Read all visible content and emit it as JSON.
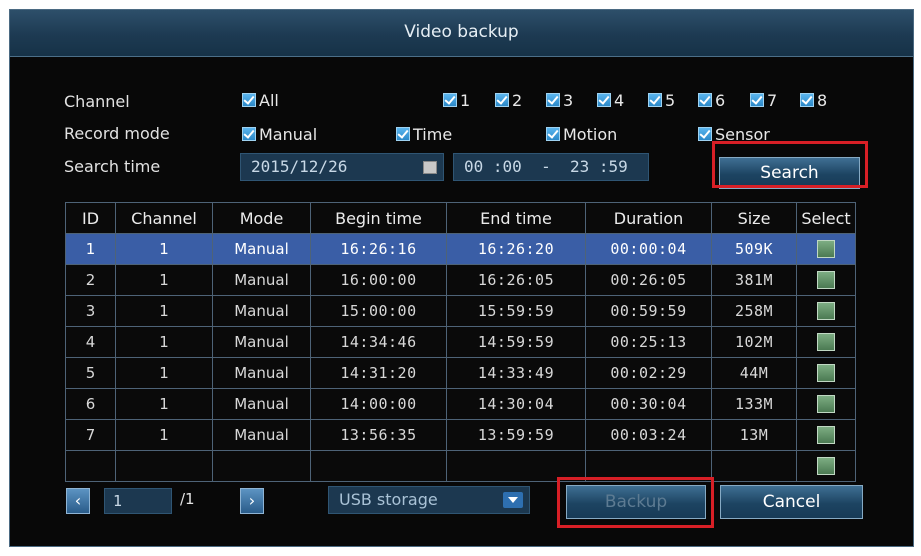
{
  "window": {
    "title": "Video backup"
  },
  "filters": {
    "channel_label": "Channel",
    "all_label": "All",
    "channels": [
      "1",
      "2",
      "3",
      "4",
      "5",
      "6",
      "7",
      "8"
    ],
    "record_mode_label": "Record mode",
    "modes": [
      "Manual",
      "Time",
      "Motion",
      "Sensor"
    ],
    "search_time_label": "Search time",
    "date": "2015/12/26",
    "time_range": "00 :00  -  23 :59",
    "search_button": "Search"
  },
  "table": {
    "headers": [
      "ID",
      "Channel",
      "Mode",
      "Begin time",
      "End time",
      "Duration",
      "Size",
      "Select"
    ],
    "rows": [
      {
        "id": "1",
        "channel": "1",
        "mode": "Manual",
        "begin": "16:26:16",
        "end": "16:26:20",
        "duration": "00:00:04",
        "size": "509K"
      },
      {
        "id": "2",
        "channel": "1",
        "mode": "Manual",
        "begin": "16:00:00",
        "end": "16:26:05",
        "duration": "00:26:05",
        "size": "381M"
      },
      {
        "id": "3",
        "channel": "1",
        "mode": "Manual",
        "begin": "15:00:00",
        "end": "15:59:59",
        "duration": "00:59:59",
        "size": "258M"
      },
      {
        "id": "4",
        "channel": "1",
        "mode": "Manual",
        "begin": "14:34:46",
        "end": "14:59:59",
        "duration": "00:25:13",
        "size": "102M"
      },
      {
        "id": "5",
        "channel": "1",
        "mode": "Manual",
        "begin": "14:31:20",
        "end": "14:33:49",
        "duration": "00:02:29",
        "size": "44M"
      },
      {
        "id": "6",
        "channel": "1",
        "mode": "Manual",
        "begin": "14:00:00",
        "end": "14:30:04",
        "duration": "00:30:04",
        "size": "133M"
      },
      {
        "id": "7",
        "channel": "1",
        "mode": "Manual",
        "begin": "13:56:35",
        "end": "13:59:59",
        "duration": "00:03:24",
        "size": "13M"
      }
    ]
  },
  "footer": {
    "prev_icon": "chevron-left-icon",
    "page_current": "1",
    "page_total": "/1",
    "next_icon": "chevron-right-icon",
    "storage": "USB storage",
    "backup_button": "Backup",
    "cancel_button": "Cancel"
  },
  "colors": {
    "accent": "#3a5ea6",
    "highlight": "#d81f26",
    "titlebar": "#1d3a52"
  }
}
